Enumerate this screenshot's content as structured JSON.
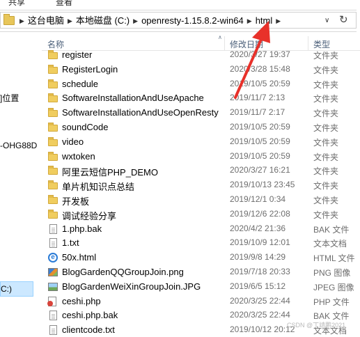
{
  "ribbon": {
    "left_label": "共享",
    "right_label": "查看"
  },
  "address": {
    "crumbs": [
      "这台电脑",
      "本地磁盘 (C:)",
      "openresty-1.15.8.2-win64",
      "html"
    ],
    "dropdown_icon": "chevron-down-icon",
    "refresh_icon": "refresh-icon"
  },
  "nav": {
    "items": [
      "]位置",
      "-OHG88D"
    ],
    "selected_label": "C:)"
  },
  "columns": {
    "name": "名称",
    "date": "修改日期",
    "type": "类型"
  },
  "files": [
    {
      "name": "register",
      "date": "2020/3/27 19:37",
      "type": "文件夹",
      "icon": "folder"
    },
    {
      "name": "RegisterLogin",
      "date": "2020/3/28 15:48",
      "type": "文件夹",
      "icon": "folder"
    },
    {
      "name": "schedule",
      "date": "2019/10/5 20:59",
      "type": "文件夹",
      "icon": "folder"
    },
    {
      "name": "SoftwareInstallationAndUseApache",
      "date": "2019/11/7 2:13",
      "type": "文件夹",
      "icon": "folder"
    },
    {
      "name": "SoftwareInstallationAndUseOpenResty",
      "date": "2019/11/7 2:17",
      "type": "文件夹",
      "icon": "folder"
    },
    {
      "name": "soundCode",
      "date": "2019/10/5 20:59",
      "type": "文件夹",
      "icon": "folder"
    },
    {
      "name": "video",
      "date": "2019/10/5 20:59",
      "type": "文件夹",
      "icon": "folder"
    },
    {
      "name": "wxtoken",
      "date": "2019/10/5 20:59",
      "type": "文件夹",
      "icon": "folder"
    },
    {
      "name": "阿里云短信PHP_DEMO",
      "date": "2020/3/27 16:21",
      "type": "文件夹",
      "icon": "folder"
    },
    {
      "name": "单片机知识点总结",
      "date": "2019/10/13 23:45",
      "type": "文件夹",
      "icon": "folder"
    },
    {
      "name": "开发板",
      "date": "2019/12/1 0:34",
      "type": "文件夹",
      "icon": "folder"
    },
    {
      "name": "调试经验分享",
      "date": "2019/12/6 22:08",
      "type": "文件夹",
      "icon": "folder"
    },
    {
      "name": "1.php.bak",
      "date": "2020/4/2 21:36",
      "type": "BAK 文件",
      "icon": "document"
    },
    {
      "name": "1.txt",
      "date": "2019/10/9 12:01",
      "type": "文本文档",
      "icon": "document"
    },
    {
      "name": "50x.html",
      "date": "2019/9/8 14:29",
      "type": "HTML 文件",
      "icon": "ie"
    },
    {
      "name": "BlogGardenQQGroupJoin.png",
      "date": "2019/7/18 20:33",
      "type": "PNG 图像",
      "icon": "png"
    },
    {
      "name": "BlogGardenWeiXinGroupJoin.JPG",
      "date": "2019/6/5 15:12",
      "type": "JPEG 图像",
      "icon": "jpg"
    },
    {
      "name": "ceshi.php",
      "date": "2020/3/25 22:44",
      "type": "PHP 文件",
      "icon": "php"
    },
    {
      "name": "ceshi.php.bak",
      "date": "2020/3/25 22:44",
      "type": "BAK 文件",
      "icon": "document"
    },
    {
      "name": "clientcode.txt",
      "date": "2019/10/12 20:12",
      "type": "文本文档",
      "icon": "document"
    }
  ],
  "watermark": "CSDN @丁靖鹏2021",
  "colors": {
    "arrow": "#e8312a",
    "selection": "#cce8ff",
    "folder": "#f0cd5f"
  }
}
